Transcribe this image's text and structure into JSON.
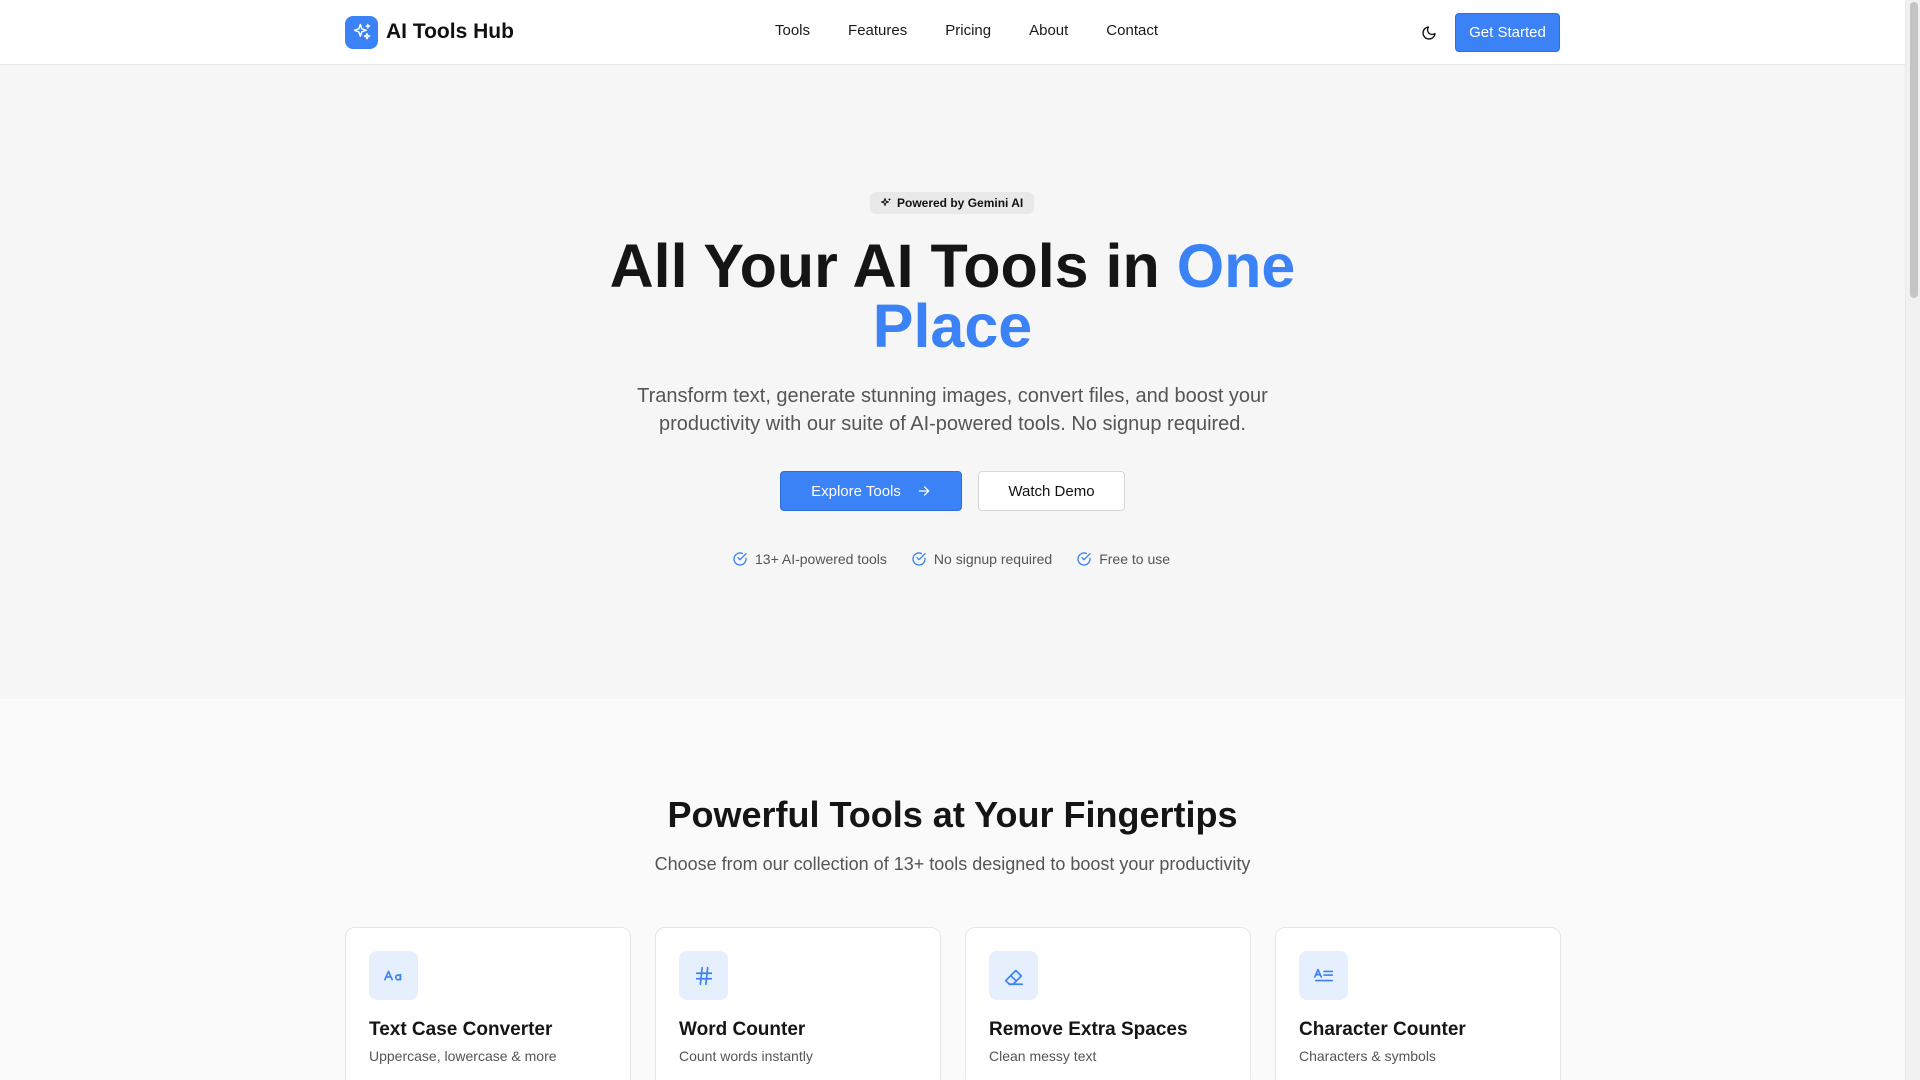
{
  "brand": {
    "name": "AI Tools Hub",
    "logo_icon": "sparkles-icon",
    "accent": "#3b82f6"
  },
  "nav": {
    "items": [
      "Tools",
      "Features",
      "Pricing",
      "About",
      "Contact"
    ]
  },
  "header": {
    "theme_icon": "moon-icon",
    "cta_label": "Get Started"
  },
  "hero": {
    "badge": "Powered by Gemini AI",
    "title_main": "All Your AI Tools in ",
    "title_accent": "One Place",
    "subtitle": "Transform text, generate stunning images, convert files, and boost your productivity with our suite of AI-powered tools. No signup required.",
    "primary_button": "Explore Tools",
    "secondary_button": "Watch Demo",
    "features": [
      "13+ AI-powered tools",
      "No signup required",
      "Free to use"
    ]
  },
  "tools": {
    "title": "Powerful Tools at Your Fingertips",
    "subtitle": "Choose from our collection of 13+ tools designed to boost your productivity",
    "cards": [
      {
        "title": "Text Case Converter",
        "desc": "Uppercase, lowercase & more",
        "icon": "text-case-icon"
      },
      {
        "title": "Word Counter",
        "desc": "Count words instantly",
        "icon": "hash-icon"
      },
      {
        "title": "Remove Extra Spaces",
        "desc": "Clean messy text",
        "icon": "eraser-icon"
      },
      {
        "title": "Character Counter",
        "desc": "Characters & symbols",
        "icon": "text-lines-icon"
      }
    ]
  }
}
